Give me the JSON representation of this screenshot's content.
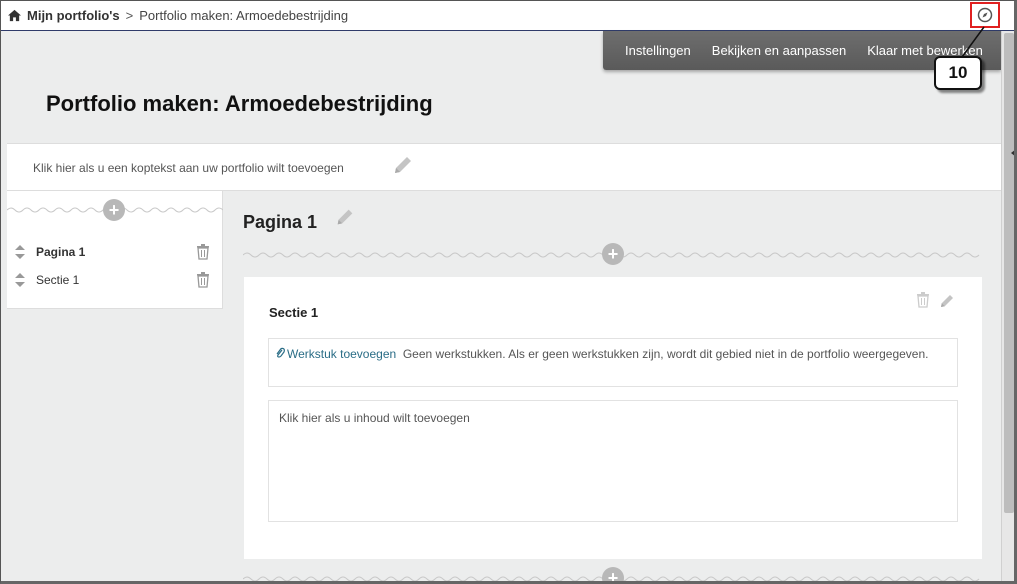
{
  "breadcrumb": {
    "home_label": "Mijn portfolio's",
    "separator": ">",
    "current": "Portfolio maken: Armoedebestrijding"
  },
  "toolbar": {
    "settings": "Instellingen",
    "view_edit": "Bekijken en aanpassen",
    "done_editing": "Klaar met bewerken"
  },
  "callout": {
    "number": "10"
  },
  "portfolio": {
    "title": "Portfolio maken: Armoedebestrijding",
    "header_placeholder": "Klik hier als u een koptekst aan uw portfolio wilt toevoegen"
  },
  "sidebar": {
    "items": [
      {
        "label": "Pagina 1",
        "bold": true
      },
      {
        "label": "Sectie 1",
        "bold": false
      }
    ]
  },
  "page": {
    "title": "Pagina 1",
    "section": {
      "title": "Sectie 1",
      "attach_link": "Werkstuk toevoegen",
      "attach_text": "Geen werkstukken. Als er geen werkstukken zijn, wordt dit gebied niet in de portfolio weergegeven.",
      "content_placeholder": "Klik hier als u inhoud wilt toevoegen"
    }
  },
  "icons": [
    "home-icon",
    "compass-icon",
    "pencil-icon",
    "plus-icon",
    "trash-icon",
    "reorder-icon",
    "paperclip-icon"
  ],
  "colors": {
    "toolbar": "#606060",
    "callout_border": "#e02020",
    "link": "#2a6d86"
  }
}
